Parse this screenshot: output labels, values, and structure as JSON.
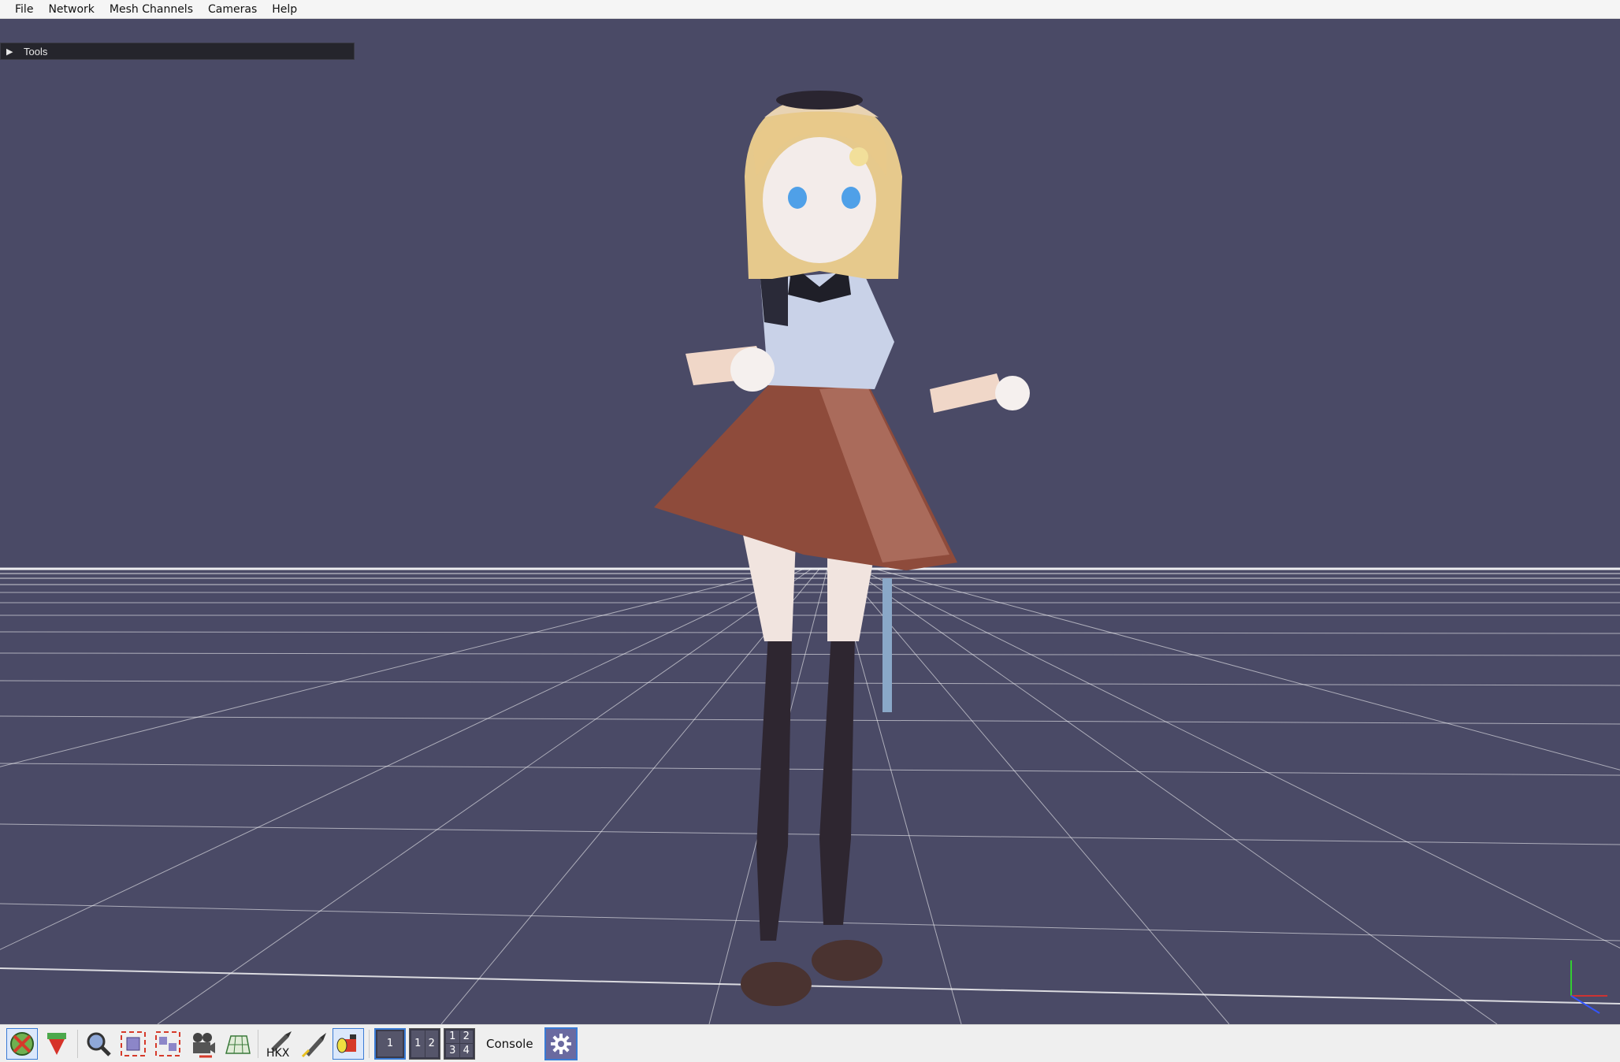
{
  "menubar": {
    "items": [
      "File",
      "Network",
      "Mesh Channels",
      "Cameras",
      "Help"
    ]
  },
  "tools_panel": {
    "label": "Tools",
    "expand_glyph": "▶"
  },
  "toolbar": {
    "buttons": [
      {
        "name": "reset-pose-icon",
        "active": true
      },
      {
        "name": "download-animation-icon",
        "active": false
      },
      {
        "name": "zoom-icon",
        "active": false
      },
      {
        "name": "frame-selected-icon",
        "active": false
      },
      {
        "name": "frame-all-icon",
        "active": false
      },
      {
        "name": "camera-record-icon",
        "active": false
      },
      {
        "name": "grid-icon",
        "active": false
      },
      {
        "name": "hkx-export-icon",
        "active": false
      },
      {
        "name": "pin-icon",
        "active": false
      },
      {
        "name": "light-icon",
        "active": true
      }
    ],
    "hkx_label": "HKX",
    "layouts": {
      "single": [
        "1"
      ],
      "double": [
        "1",
        "2"
      ],
      "quad": [
        "1",
        "2",
        "3",
        "4"
      ]
    },
    "console_label": "Console",
    "settings_icon": "gear-icon"
  },
  "colors": {
    "viewport_bg": "#4a4a66",
    "grid_line": "#ffffff",
    "accent": "#3a7bd5"
  }
}
